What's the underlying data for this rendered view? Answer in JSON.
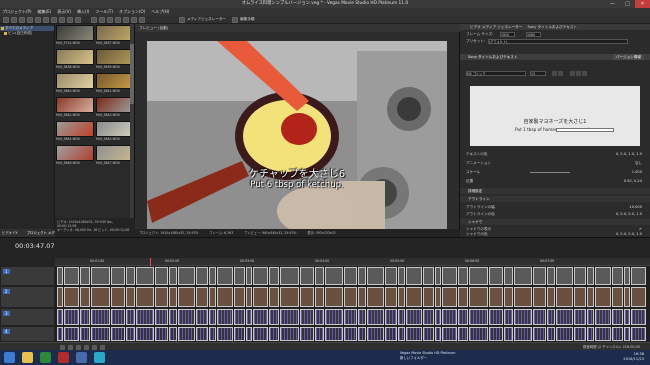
{
  "window": {
    "title": "オムライス料理シンプルバージョン.veg * - Vegas Movie Studio HD Platinum 11.0",
    "minimize": "—",
    "maximize": "□",
    "close": "✕"
  },
  "menu": [
    "プロジェクト(P)",
    "編集(E)",
    "表示(V)",
    "挿入(I)",
    "ツール(T)",
    "オプション(O)",
    "ヘルプ(H)"
  ],
  "toolbar": {
    "media_generators": "メディアジェネレーター",
    "event_tool": "編集手順"
  },
  "tree": {
    "items": [
      "すべてのメディア",
      "ビン(自己作成)"
    ],
    "bottom_tabs": [
      "ビデオ FX",
      "プロジェクト メディア",
      "エクスプローラ"
    ]
  },
  "media": {
    "clips": [
      "MVI_3714.MOV",
      "MVI_3837.MOV",
      "MVI_3838.MOV",
      "MVI_3839.MOV",
      "MVI_3840.MOV",
      "MVI_3841.MOV",
      "MVI_3842.MOV",
      "MVI_3843.MOV",
      "MVI_3844.MOV",
      "MVI_3845.MOV",
      "MVI_3846.MOV",
      "MVI_3847.MOV"
    ],
    "info": [
      "ビデオ: 1920x1080x32, 59.940 fps, 00:00:12;06",
      "オーディオ: 48,000 Hz, 16 ビット, 00:00:12;06"
    ]
  },
  "preview": {
    "toolbar_label": "プレビュー (自動)",
    "subtitle_jp": "ケチャップを大さじ6",
    "subtitle_en": "Put 6 tbsp of ketchup.",
    "info_project": "プロジェクト: 1920x1080x32, 29.970i",
    "info_preview": "プレビュー: 960x540x32, 29.970i",
    "frame_label": "フレーム: 6,363",
    "display_label": "表示: 592x333x32"
  },
  "props": {
    "tabs": [
      "ビデオ メディア ジェネレーター",
      "Sony タイトルおよびテキスト"
    ],
    "frame_size_label": "フレーム サイズ:",
    "frame_w": "1920",
    "frame_h": "1080",
    "preset_label": "プリセット:",
    "preset_value": "(デフォルト)",
    "plugin_name": "Sony タイトルおよびテキスト",
    "version": "バージョン情報",
    "font": "MS ゴシック",
    "font_size": "13",
    "preview_jp": "自家製マヨネーズを大さじ1",
    "preview_en": "Put 1 tbsp of homemade mayonnaise.",
    "rows": [
      {
        "label": "テキストの色",
        "value": "0, 0.0, 1.0, 1.0"
      },
      {
        "label": "アニメーション",
        "value": "なし"
      },
      {
        "label": "スケール",
        "value": "1.000"
      },
      {
        "label": "位置",
        "value": "0.50, 0.24"
      }
    ],
    "sections": [
      "詳細設定",
      "アウトライン",
      "シャドウ"
    ],
    "outline_rows": [
      {
        "label": "アウトラインの幅",
        "value": "10.000"
      },
      {
        "label": "アウトラインの色",
        "value": "0, 0.0, 0.0, 1.0"
      }
    ],
    "shadow_rows": [
      {
        "label": "シャドウの表示",
        "value": "✔"
      },
      {
        "label": "シャドウの色",
        "value": "0, 0.0, 0.0, 1.0"
      },
      {
        "label": "シャドウ オフセット",
        "value": "0.000"
      }
    ]
  },
  "timeline": {
    "timecode": "00:03:47.07",
    "ruler": [
      "00:00:00",
      "00:01:00",
      "00:02:00",
      "00:03:00",
      "00:04:00",
      "00:05:00",
      "00:06:00",
      "00:07:00"
    ],
    "tracks": [
      "1",
      "2",
      "3",
      "4"
    ],
    "status": "録音時間 (2 チャンネル): 216:00:45"
  },
  "taskbar": {
    "time": "16:38",
    "date": "2016/11/23",
    "notices": [
      "Vegas Movie Studio HD Platinum",
      "新しいフォルダー"
    ]
  }
}
